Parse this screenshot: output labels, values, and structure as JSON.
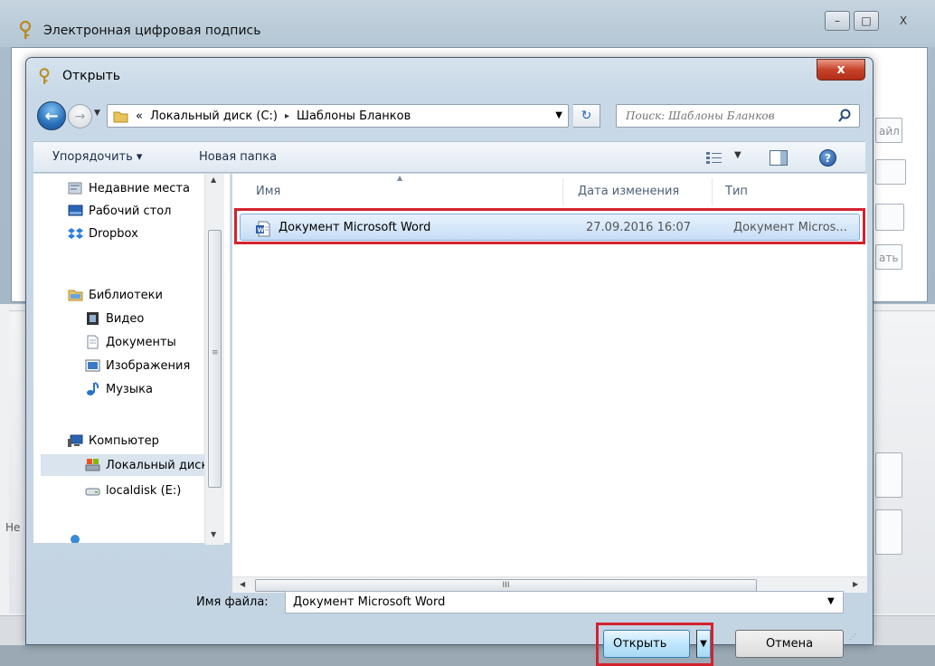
{
  "parent_window": {
    "title": "Электронная цифровая подпись",
    "minimize": "–",
    "maximize": "□",
    "close": "X",
    "fragments": {
      "right_top": "айл",
      "right_mid": "ать",
      "left_low": "Не"
    }
  },
  "dialog": {
    "title": "Открыть",
    "close": "x",
    "address": {
      "overflow": "«",
      "crumbs": [
        "Локальный диск (C:)",
        "Шаблоны Бланков"
      ],
      "separator": "▸"
    },
    "search": {
      "placeholder": "Поиск: Шаблоны Бланков"
    },
    "toolbar": {
      "organize": "Упорядочить ▾",
      "new_folder": "Новая папка",
      "help": "?"
    },
    "nav": [
      {
        "label": "Недавние места",
        "icon": "recent-places-icon",
        "selected": false
      },
      {
        "label": "Рабочий стол",
        "icon": "desktop-icon",
        "selected": false
      },
      {
        "label": "Dropbox",
        "icon": "dropbox-icon",
        "selected": false
      },
      {
        "label": "Библиотеки",
        "icon": "libraries-icon",
        "selected": false
      },
      {
        "label": "Видео",
        "icon": "video-icon",
        "selected": false
      },
      {
        "label": "Документы",
        "icon": "documents-icon",
        "selected": false
      },
      {
        "label": "Изображения",
        "icon": "pictures-icon",
        "selected": false
      },
      {
        "label": "Музыка",
        "icon": "music-icon",
        "selected": false
      },
      {
        "label": "Компьютер",
        "icon": "computer-icon",
        "selected": false
      },
      {
        "label": "Локальный диск",
        "icon": "local-disk-icon",
        "selected": true
      },
      {
        "label": "localdisk (E:)",
        "icon": "drive-icon",
        "selected": false
      }
    ],
    "columns": {
      "name": "Имя",
      "date": "Дата изменения",
      "type": "Тип"
    },
    "files": [
      {
        "name": "Документ Microsoft Word",
        "date": "27.09.2016 16:07",
        "type": "Документ Micros..."
      }
    ],
    "filename_label": "Имя файла:",
    "filename_value": "Документ Microsoft Word",
    "open": "Открыть",
    "cancel": "Отмена",
    "hscroll_grip": "III"
  },
  "colors": {
    "highlight": "#d3222e",
    "selection": "#c6ddf6"
  }
}
